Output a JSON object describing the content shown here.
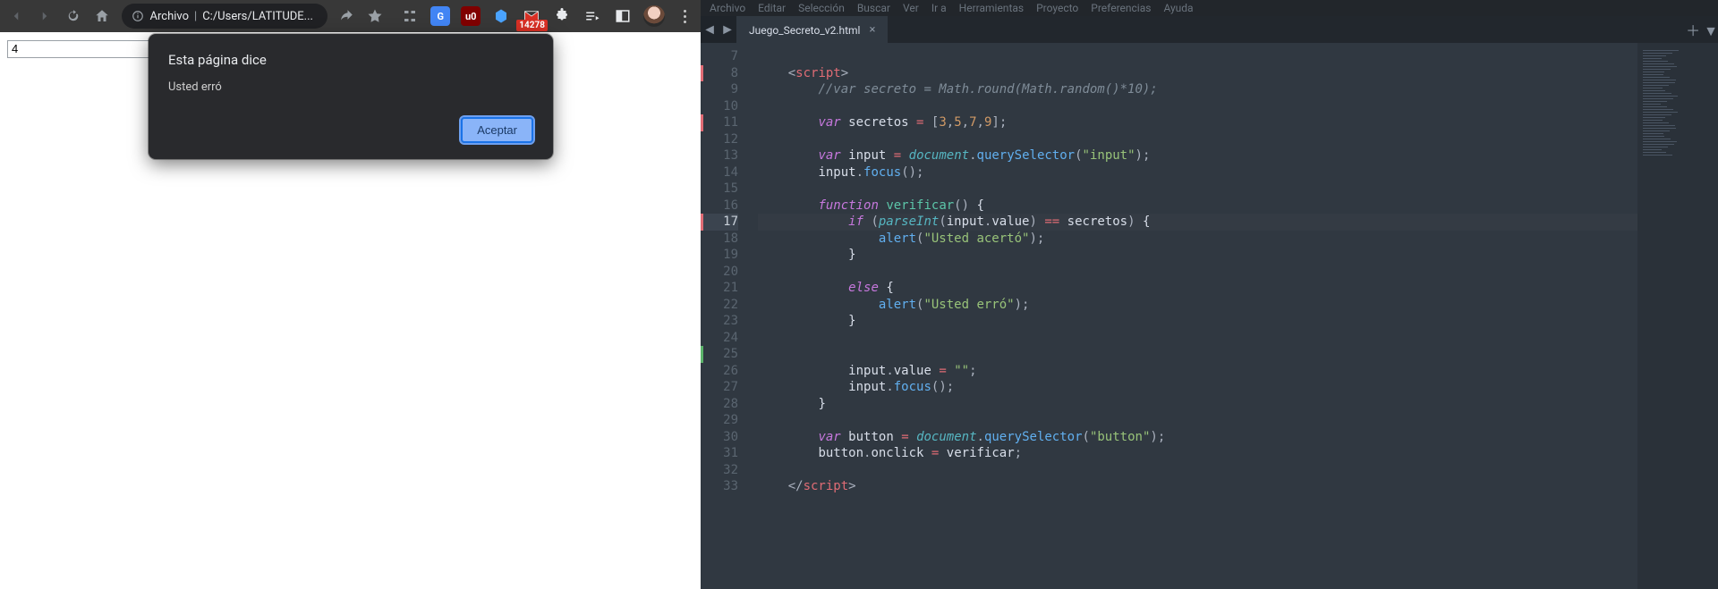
{
  "chrome": {
    "address": {
      "scheme_label": "Archivo",
      "path": "C:/Users/LATITUDE..."
    },
    "extension_badge": "14278",
    "page": {
      "input_value": "4"
    },
    "dialog": {
      "title": "Esta página dice",
      "message": "Usted erró",
      "accept": "Aceptar"
    }
  },
  "sublime": {
    "menu": [
      "Archivo",
      "Editar",
      "Selección",
      "Buscar",
      "Ver",
      "Ir a",
      "Herramientas",
      "Proyecto",
      "Preferencias",
      "Ayuda"
    ],
    "tab": {
      "name": "Juego_Secreto_v2.html"
    },
    "first_line_number": 7,
    "highlighted_line": 17,
    "red_marks": [
      8,
      11,
      17
    ],
    "green_marks": [
      25
    ],
    "code_lines": [
      {
        "n": 7,
        "tokens": []
      },
      {
        "n": 8,
        "tokens": [
          [
            "pun",
            "    <"
          ],
          [
            "tag",
            "script"
          ],
          [
            "pun",
            ">"
          ]
        ]
      },
      {
        "n": 9,
        "tokens": [
          [
            "pun",
            "        "
          ],
          [
            "cmt",
            "//var secreto = Math.round(Math.random()*10);"
          ]
        ]
      },
      {
        "n": 10,
        "tokens": []
      },
      {
        "n": 11,
        "tokens": [
          [
            "pun",
            "        "
          ],
          [
            "kw",
            "var"
          ],
          [
            "pun",
            " "
          ],
          [
            "id",
            "secretos"
          ],
          [
            "pun",
            " "
          ],
          [
            "op",
            "="
          ],
          [
            "pun",
            " ["
          ],
          [
            "num",
            "3"
          ],
          [
            "pun",
            ","
          ],
          [
            "num",
            "5"
          ],
          [
            "pun",
            ","
          ],
          [
            "num",
            "7"
          ],
          [
            "pun",
            ","
          ],
          [
            "num",
            "9"
          ],
          [
            "pun",
            "];"
          ]
        ]
      },
      {
        "n": 12,
        "tokens": []
      },
      {
        "n": 13,
        "tokens": [
          [
            "pun",
            "        "
          ],
          [
            "kw",
            "var"
          ],
          [
            "pun",
            " "
          ],
          [
            "id",
            "input"
          ],
          [
            "pun",
            " "
          ],
          [
            "op",
            "="
          ],
          [
            "pun",
            " "
          ],
          [
            "obj",
            "document"
          ],
          [
            "pun",
            "."
          ],
          [
            "fn",
            "querySelector"
          ],
          [
            "pun",
            "("
          ],
          [
            "str",
            "\"input\""
          ],
          [
            "pun",
            ");"
          ]
        ]
      },
      {
        "n": 14,
        "tokens": [
          [
            "pun",
            "        "
          ],
          [
            "id",
            "input"
          ],
          [
            "pun",
            "."
          ],
          [
            "fn",
            "focus"
          ],
          [
            "pun",
            "();"
          ]
        ]
      },
      {
        "n": 15,
        "tokens": []
      },
      {
        "n": 16,
        "tokens": [
          [
            "pun",
            "        "
          ],
          [
            "kw",
            "function"
          ],
          [
            "pun",
            " "
          ],
          [
            "fnname",
            "verificar"
          ],
          [
            "pun",
            "() "
          ],
          [
            "br",
            "{"
          ]
        ]
      },
      {
        "n": 17,
        "tokens": [
          [
            "pun",
            "            "
          ],
          [
            "kw",
            "if"
          ],
          [
            "pun",
            " ("
          ],
          [
            "obj",
            "parseInt"
          ],
          [
            "pun",
            "("
          ],
          [
            "id",
            "input"
          ],
          [
            "pun",
            "."
          ],
          [
            "id",
            "value"
          ],
          [
            "pun",
            ") "
          ],
          [
            "op",
            "=="
          ],
          [
            "pun",
            " "
          ],
          [
            "id",
            "secretos"
          ],
          [
            "pun",
            ") "
          ],
          [
            "br",
            "{"
          ]
        ]
      },
      {
        "n": 18,
        "tokens": [
          [
            "pun",
            "                "
          ],
          [
            "fn",
            "alert"
          ],
          [
            "pun",
            "("
          ],
          [
            "str",
            "\"Usted acertó\""
          ],
          [
            "pun",
            ");"
          ]
        ]
      },
      {
        "n": 19,
        "tokens": [
          [
            "pun",
            "            "
          ],
          [
            "br",
            "}"
          ]
        ]
      },
      {
        "n": 20,
        "tokens": []
      },
      {
        "n": 21,
        "tokens": [
          [
            "pun",
            "            "
          ],
          [
            "kw",
            "else"
          ],
          [
            "pun",
            " "
          ],
          [
            "br",
            "{"
          ]
        ]
      },
      {
        "n": 22,
        "tokens": [
          [
            "pun",
            "                "
          ],
          [
            "fn",
            "alert"
          ],
          [
            "pun",
            "("
          ],
          [
            "str",
            "\"Usted erró\""
          ],
          [
            "pun",
            ");"
          ]
        ]
      },
      {
        "n": 23,
        "tokens": [
          [
            "pun",
            "            "
          ],
          [
            "br",
            "}"
          ]
        ]
      },
      {
        "n": 24,
        "tokens": []
      },
      {
        "n": 25,
        "tokens": []
      },
      {
        "n": 26,
        "tokens": [
          [
            "pun",
            "            "
          ],
          [
            "id",
            "input"
          ],
          [
            "pun",
            "."
          ],
          [
            "id",
            "value"
          ],
          [
            "pun",
            " "
          ],
          [
            "op",
            "="
          ],
          [
            "pun",
            " "
          ],
          [
            "str",
            "\"\""
          ],
          [
            "pun",
            ";"
          ]
        ]
      },
      {
        "n": 27,
        "tokens": [
          [
            "pun",
            "            "
          ],
          [
            "id",
            "input"
          ],
          [
            "pun",
            "."
          ],
          [
            "fn",
            "focus"
          ],
          [
            "pun",
            "();"
          ]
        ]
      },
      {
        "n": 28,
        "tokens": [
          [
            "pun",
            "        "
          ],
          [
            "br",
            "}"
          ]
        ]
      },
      {
        "n": 29,
        "tokens": []
      },
      {
        "n": 30,
        "tokens": [
          [
            "pun",
            "        "
          ],
          [
            "kw",
            "var"
          ],
          [
            "pun",
            " "
          ],
          [
            "id",
            "button"
          ],
          [
            "pun",
            " "
          ],
          [
            "op",
            "="
          ],
          [
            "pun",
            " "
          ],
          [
            "obj",
            "document"
          ],
          [
            "pun",
            "."
          ],
          [
            "fn",
            "querySelector"
          ],
          [
            "pun",
            "("
          ],
          [
            "str",
            "\"button\""
          ],
          [
            "pun",
            ");"
          ]
        ]
      },
      {
        "n": 31,
        "tokens": [
          [
            "pun",
            "        "
          ],
          [
            "id",
            "button"
          ],
          [
            "pun",
            "."
          ],
          [
            "id",
            "onclick"
          ],
          [
            "pun",
            " "
          ],
          [
            "op",
            "="
          ],
          [
            "pun",
            " "
          ],
          [
            "id",
            "verificar"
          ],
          [
            "pun",
            ";"
          ]
        ]
      },
      {
        "n": 32,
        "tokens": []
      },
      {
        "n": 33,
        "tokens": [
          [
            "pun",
            "    </"
          ],
          [
            "tag",
            "script"
          ],
          [
            "pun",
            ">"
          ]
        ]
      }
    ]
  }
}
